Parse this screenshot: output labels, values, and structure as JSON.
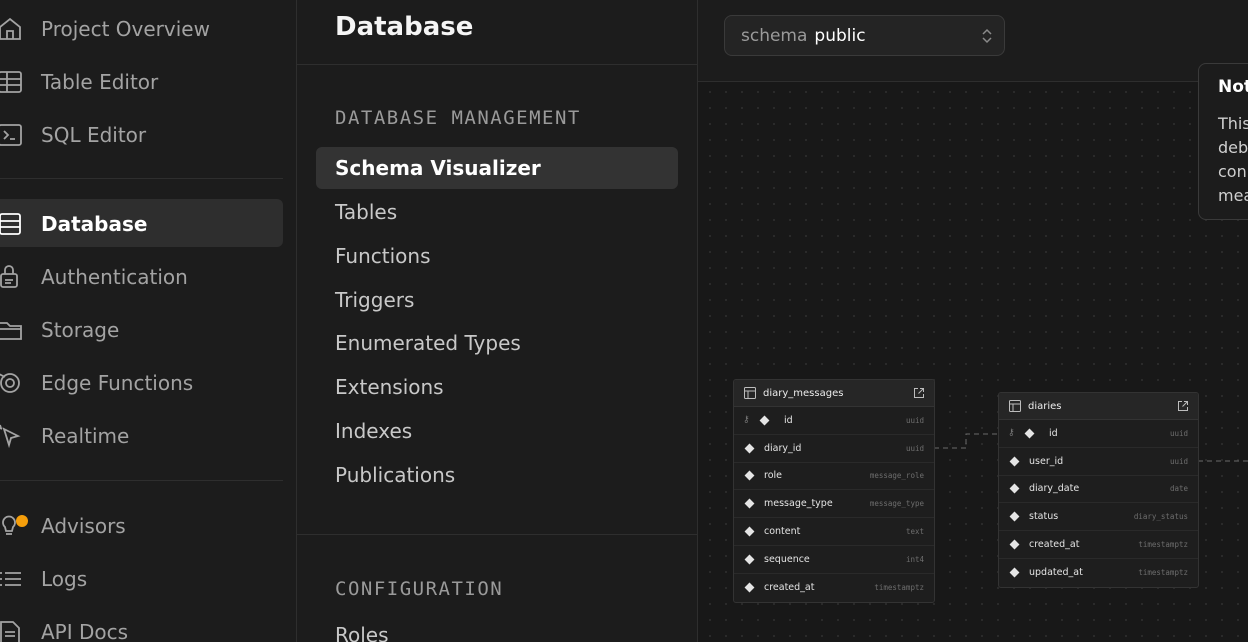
{
  "nav": {
    "items": [
      {
        "label": "Project Overview",
        "icon": "home-icon"
      },
      {
        "label": "Table Editor",
        "icon": "table-icon"
      },
      {
        "label": "SQL Editor",
        "icon": "terminal-icon"
      },
      {
        "label": "Database",
        "icon": "database-icon",
        "active": true
      },
      {
        "label": "Authentication",
        "icon": "lock-icon"
      },
      {
        "label": "Storage",
        "icon": "folder-icon"
      },
      {
        "label": "Edge Functions",
        "icon": "edge-functions-icon"
      },
      {
        "label": "Realtime",
        "icon": "cursor-icon"
      },
      {
        "label": "Advisors",
        "icon": "lightbulb-icon"
      },
      {
        "label": "Logs",
        "icon": "list-icon"
      },
      {
        "label": "API Docs",
        "icon": "document-icon"
      }
    ]
  },
  "menu": {
    "title": "Database",
    "sections": [
      {
        "heading": "DATABASE MANAGEMENT",
        "items": [
          "Schema Visualizer",
          "Tables",
          "Functions",
          "Triggers",
          "Enumerated Types",
          "Extensions",
          "Indexes",
          "Publications"
        ]
      },
      {
        "heading": "CONFIGURATION",
        "items": [
          "Roles"
        ]
      }
    ],
    "active_item": "Schema Visualizer"
  },
  "canvas": {
    "schema": {
      "prefix": "schema",
      "value": "public"
    },
    "notice": {
      "title": "Not",
      "lines": [
        "This",
        "deb",
        "con",
        "mea"
      ]
    },
    "tables": [
      {
        "name": "diary_messages",
        "columns": [
          {
            "name": "id",
            "type": "uuid",
            "pk": true
          },
          {
            "name": "diary_id",
            "type": "uuid"
          },
          {
            "name": "role",
            "type": "message_role"
          },
          {
            "name": "message_type",
            "type": "message_type"
          },
          {
            "name": "content",
            "type": "text"
          },
          {
            "name": "sequence",
            "type": "int4"
          },
          {
            "name": "created_at",
            "type": "timestamptz"
          }
        ]
      },
      {
        "name": "diaries",
        "columns": [
          {
            "name": "id",
            "type": "uuid",
            "pk": true
          },
          {
            "name": "user_id",
            "type": "uuid"
          },
          {
            "name": "diary_date",
            "type": "date"
          },
          {
            "name": "status",
            "type": "diary_status"
          },
          {
            "name": "created_at",
            "type": "timestamptz"
          },
          {
            "name": "updated_at",
            "type": "timestamptz"
          }
        ]
      }
    ]
  },
  "colors": {
    "accent_dot": "#f59e0b",
    "active_bg": "#2e2e2e"
  }
}
